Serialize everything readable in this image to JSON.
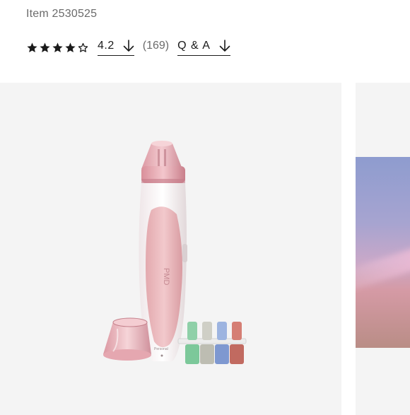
{
  "product": {
    "item_number": "Item 2530525",
    "rating": {
      "stars_filled": 4,
      "stars_total": 5,
      "value": "4.2",
      "review_count": "(169)"
    },
    "qa_label": "Q & A",
    "icons": {
      "star_filled": "star-filled-icon",
      "star_empty": "star-outline-icon",
      "arrow": "arrow-down-icon"
    }
  },
  "gallery": {
    "main_image": "pink-handheld-microderm-device-with-filters",
    "next_image": "partial-preview-pink-blur",
    "device_brand_text": "PMD"
  },
  "colors": {
    "text": "#1a1a1a",
    "muted": "#6b6b6b",
    "gallery_bg": "#f4f4f4",
    "device_pink": "#e8b9bd",
    "device_white": "#fbf7f8"
  }
}
